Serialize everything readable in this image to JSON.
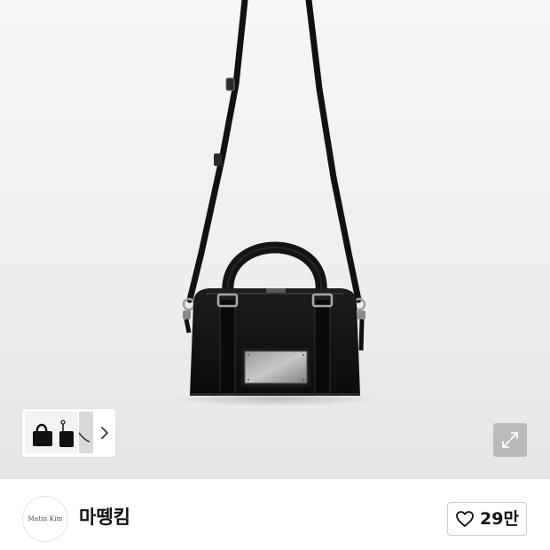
{
  "hero": {
    "image": "black-mini-duffle-crossbody-bag",
    "expand_icon": "expand-arrows-icon"
  },
  "gallery": {
    "thumbnails": [
      "bag-front-thumbnail",
      "bag-partial-thumbnail"
    ],
    "next_icon": "chevron-right-icon"
  },
  "brand": {
    "logo_text": "Matin  Kim",
    "name": "마뗑킴"
  },
  "like": {
    "icon": "heart-outline-icon",
    "count": "29만"
  }
}
